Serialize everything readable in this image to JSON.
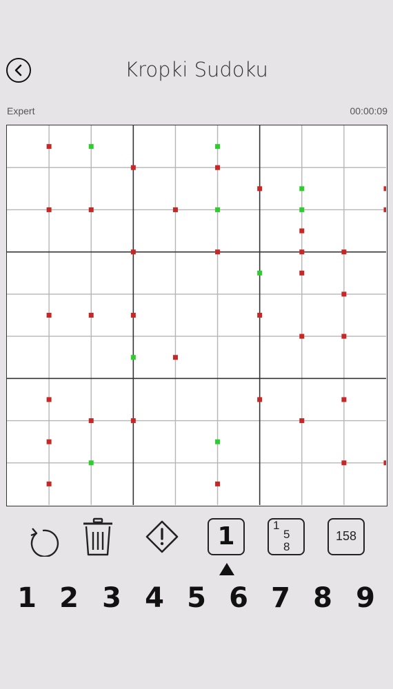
{
  "header": {
    "title": "Kropki Sudoku",
    "back_icon": "chevron-left-icon"
  },
  "status": {
    "difficulty": "Expert",
    "timer": "00:00:09"
  },
  "board": {
    "size": 9,
    "dot_colors": {
      "red": "#c62828",
      "green": "#2ecc2e"
    },
    "horizontal_dots": [
      {
        "r": 0,
        "c": 0,
        "color": "red"
      },
      {
        "r": 0,
        "c": 1,
        "color": "green"
      },
      {
        "r": 0,
        "c": 4,
        "color": "green"
      },
      {
        "r": 1,
        "c": 5,
        "color": "red"
      },
      {
        "r": 1,
        "c": 6,
        "color": "green"
      },
      {
        "r": 1,
        "c": 8,
        "color": "red"
      },
      {
        "r": 2,
        "c": 6,
        "color": "red"
      },
      {
        "r": 3,
        "c": 5,
        "color": "green"
      },
      {
        "r": 3,
        "c": 6,
        "color": "red"
      },
      {
        "r": 4,
        "c": 0,
        "color": "red"
      },
      {
        "r": 4,
        "c": 1,
        "color": "red"
      },
      {
        "r": 4,
        "c": 2,
        "color": "red"
      },
      {
        "r": 4,
        "c": 5,
        "color": "red"
      },
      {
        "r": 5,
        "c": 2,
        "color": "green"
      },
      {
        "r": 5,
        "c": 3,
        "color": "red"
      },
      {
        "r": 6,
        "c": 0,
        "color": "red"
      },
      {
        "r": 6,
        "c": 5,
        "color": "red"
      },
      {
        "r": 6,
        "c": 7,
        "color": "red"
      },
      {
        "r": 7,
        "c": 0,
        "color": "red"
      },
      {
        "r": 7,
        "c": 4,
        "color": "green"
      },
      {
        "r": 8,
        "c": 0,
        "color": "red"
      },
      {
        "r": 8,
        "c": 4,
        "color": "red"
      }
    ],
    "vertical_dots": [
      {
        "r": 0,
        "c": 2,
        "color": "red"
      },
      {
        "r": 0,
        "c": 4,
        "color": "red"
      },
      {
        "r": 1,
        "c": 0,
        "color": "red"
      },
      {
        "r": 1,
        "c": 1,
        "color": "red"
      },
      {
        "r": 1,
        "c": 3,
        "color": "red"
      },
      {
        "r": 1,
        "c": 4,
        "color": "green"
      },
      {
        "r": 1,
        "c": 6,
        "color": "green"
      },
      {
        "r": 1,
        "c": 8,
        "color": "red"
      },
      {
        "r": 2,
        "c": 2,
        "color": "red"
      },
      {
        "r": 2,
        "c": 4,
        "color": "red"
      },
      {
        "r": 2,
        "c": 6,
        "color": "red"
      },
      {
        "r": 2,
        "c": 7,
        "color": "red"
      },
      {
        "r": 3,
        "c": 7,
        "color": "red"
      },
      {
        "r": 4,
        "c": 6,
        "color": "red"
      },
      {
        "r": 4,
        "c": 7,
        "color": "red"
      },
      {
        "r": 6,
        "c": 1,
        "color": "red"
      },
      {
        "r": 6,
        "c": 2,
        "color": "red"
      },
      {
        "r": 6,
        "c": 6,
        "color": "red"
      },
      {
        "r": 7,
        "c": 1,
        "color": "green"
      },
      {
        "r": 7,
        "c": 7,
        "color": "red"
      },
      {
        "r": 7,
        "c": 8,
        "color": "red"
      }
    ]
  },
  "toolbar": {
    "undo_icon": "undo-icon",
    "erase_icon": "trash-icon",
    "hint_icon": "warning-diamond-icon",
    "mode_normal_label": "1",
    "mode_pencil_corner_labels": [
      "1",
      "5",
      "8"
    ],
    "mode_pencil_center_label": "158",
    "selected_mode": "normal",
    "selected_indicator_icon": "triangle-up-icon"
  },
  "numpad": {
    "keys": [
      "1",
      "2",
      "3",
      "4",
      "5",
      "6",
      "7",
      "8",
      "9"
    ]
  }
}
